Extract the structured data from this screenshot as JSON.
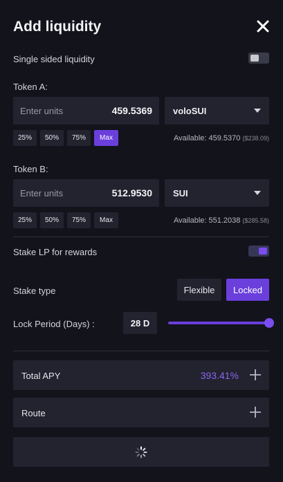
{
  "header": {
    "title": "Add liquidity",
    "close_icon": "close-icon"
  },
  "single_sided": {
    "label": "Single sided liquidity",
    "enabled": false
  },
  "token_a": {
    "label": "Token A:",
    "placeholder": "Enter units",
    "amount": "459.5369",
    "token": "voloSUI",
    "percent_buttons": [
      "25%",
      "50%",
      "75%",
      "Max"
    ],
    "active_percent": "Max",
    "available": "Available: 459.5370",
    "available_usd": "($238.09)"
  },
  "token_b": {
    "label": "Token B:",
    "placeholder": "Enter units",
    "amount": "512.9530",
    "token": "SUI",
    "percent_buttons": [
      "25%",
      "50%",
      "75%",
      "Max"
    ],
    "active_percent": null,
    "available": "Available: 551.2038",
    "available_usd": "($285.58)"
  },
  "stake_lp": {
    "label": "Stake LP for rewards",
    "enabled": true
  },
  "stake_type": {
    "label": "Stake type",
    "options": [
      "Flexible",
      "Locked"
    ],
    "selected": "Locked"
  },
  "lock_period": {
    "label": "Lock Period (Days) :",
    "value": "28 D",
    "slider_fraction": 1.0
  },
  "total_apy": {
    "label": "Total APY",
    "value": "393.41%"
  },
  "route": {
    "label": "Route"
  },
  "colors": {
    "accent": "#6a3fdc",
    "apy": "#8b65f2",
    "background": "#13131c",
    "panel": "#22232f"
  }
}
